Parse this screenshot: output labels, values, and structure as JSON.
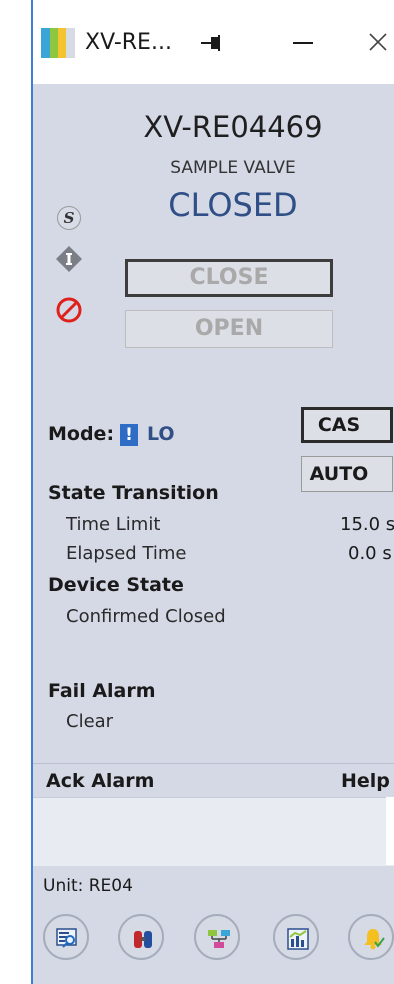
{
  "window": {
    "title": "XV-RE..."
  },
  "faceplate": {
    "tag": "XV-RE04469",
    "description": "SAMPLE VALVE",
    "pv_state": "CLOSED"
  },
  "status_icons": [
    "simulate-icon",
    "interlock-icon",
    "disabled-icon"
  ],
  "commands": {
    "close_label": "CLOSE",
    "open_label": "OPEN"
  },
  "mode": {
    "label": "Mode:",
    "flag": "!",
    "value": "LO",
    "cas_label": "CAS",
    "auto_label": "AUTO"
  },
  "state_transition": {
    "title": "State Transition",
    "time_limit_label": "Time Limit",
    "time_limit_value": "15.0 s",
    "elapsed_label": "Elapsed Time",
    "elapsed_value": "0.0 s"
  },
  "device_state": {
    "title": "Device State",
    "value": "Confirmed Closed"
  },
  "fail_alarm": {
    "title": "Fail Alarm",
    "value": "Clear"
  },
  "alarm_panel": {
    "ack_label": "Ack Alarm",
    "help_label": "Help"
  },
  "unit": {
    "label": "Unit:",
    "value": "RE04"
  },
  "toolbar": [
    "detail-icon",
    "valve-icon",
    "network-icon",
    "trend-icon",
    "alarm-bell-icon"
  ],
  "colors": {
    "pv": "#2f4f86",
    "window_bg": "#d4d9e5",
    "accent": "#2f6cc6",
    "block": "#e0201b"
  }
}
